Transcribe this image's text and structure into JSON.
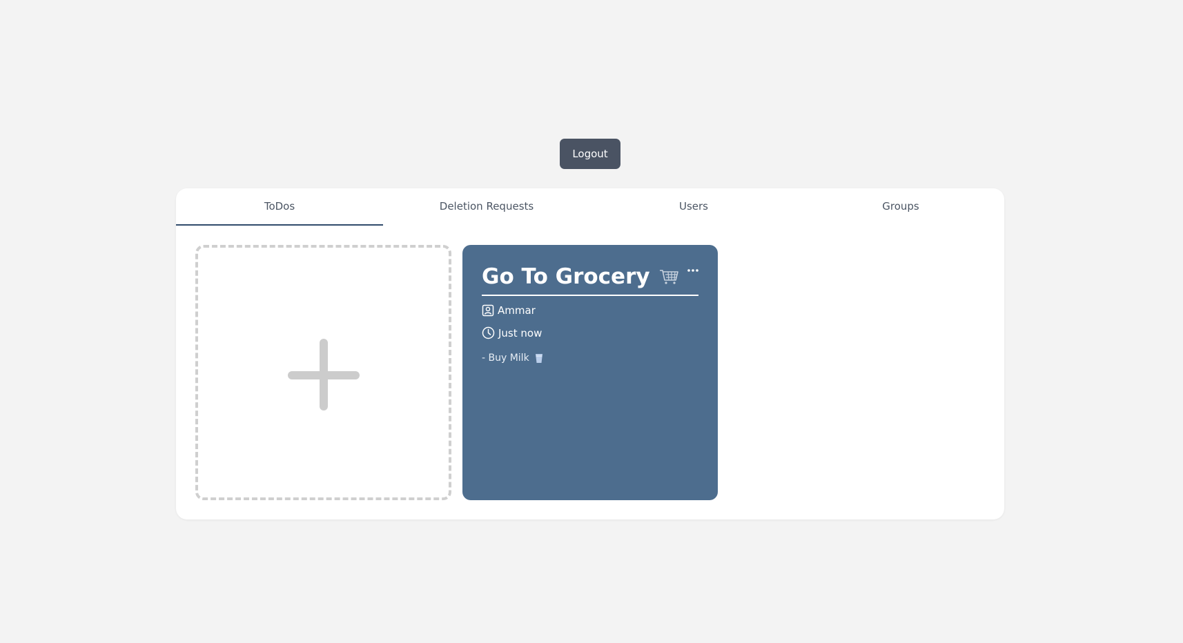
{
  "header": {
    "logout_label": "Logout"
  },
  "tabs": [
    {
      "label": "ToDos",
      "active": true
    },
    {
      "label": "Deletion Requests",
      "active": false
    },
    {
      "label": "Users",
      "active": false
    },
    {
      "label": "Groups",
      "active": false
    }
  ],
  "add_card": {
    "icon": "plus-icon"
  },
  "todo": {
    "title": "Go To Grocery",
    "title_icon": "shopping-cart-icon",
    "author": "Ammar",
    "time": "Just now",
    "items": [
      {
        "text": "- Buy Milk",
        "icon": "milk-glass-icon"
      }
    ],
    "background_color": "#4d6d8e"
  },
  "colors": {
    "page_background": "#f3f3f3",
    "logout_button": "#4a5363",
    "active_tab_underline": "#2f4a6b",
    "add_card_border": "#cfcfcf"
  }
}
